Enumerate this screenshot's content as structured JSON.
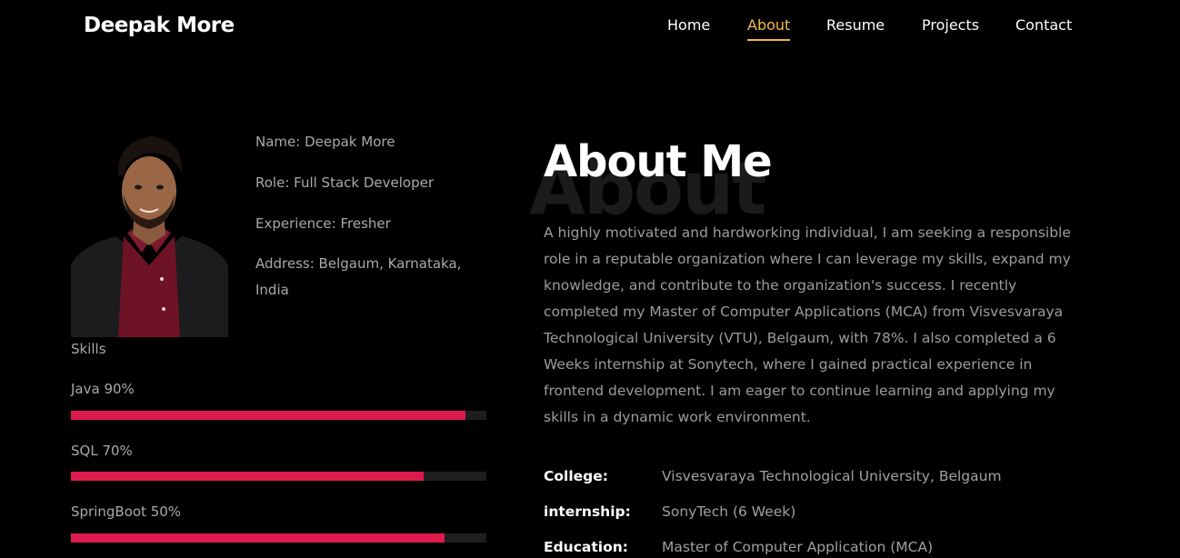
{
  "header": {
    "logo": "Deepak More",
    "nav": [
      {
        "label": "Home",
        "active": false
      },
      {
        "label": "About",
        "active": true
      },
      {
        "label": "Resume",
        "active": false
      },
      {
        "label": "Projects",
        "active": false
      },
      {
        "label": "Contact",
        "active": false
      }
    ],
    "accent_color": "#f2b84b"
  },
  "profile": {
    "name_line": "Name: Deepak More",
    "role_line": "Role: Full Stack Developer",
    "experience_line": "Experience: Fresher",
    "address_line1": "Address: Belgaum, Karnataka,",
    "address_line2": "India"
  },
  "skills": {
    "title": "Skills",
    "bar_color": "#dc1a4c",
    "items": [
      {
        "label": "Java 90%",
        "fill": 0.95
      },
      {
        "label": "SQL 70%",
        "fill": 0.85
      },
      {
        "label": "SpringBoot 50%",
        "fill": 0.9
      }
    ]
  },
  "about": {
    "bg_word": "About",
    "title": "About Me",
    "lines": [
      "A highly motivated and hardworking individual, I am seeking a responsible",
      "role in a reputable organization where I can leverage my skills, expand my",
      "knowledge, and contribute to the organization's success. I recently",
      "completed my Master of Computer Applications (MCA) from Visvesvaraya",
      "Technological University (VTU), Belgaum, with 78%. I also completed a 6",
      "Weeks internship at Sonytech, where I gained practical experience in",
      "frontend development. I am eager to continue learning and applying my",
      "skills in a dynamic work environment."
    ]
  },
  "details": [
    {
      "key": "College:",
      "value": "Visvesvaraya Technological University, Belgaum"
    },
    {
      "key": "internship:",
      "value": "SonyTech (6 Week)"
    },
    {
      "key": "Education:",
      "value": "Master of Computer Application (MCA)"
    }
  ]
}
